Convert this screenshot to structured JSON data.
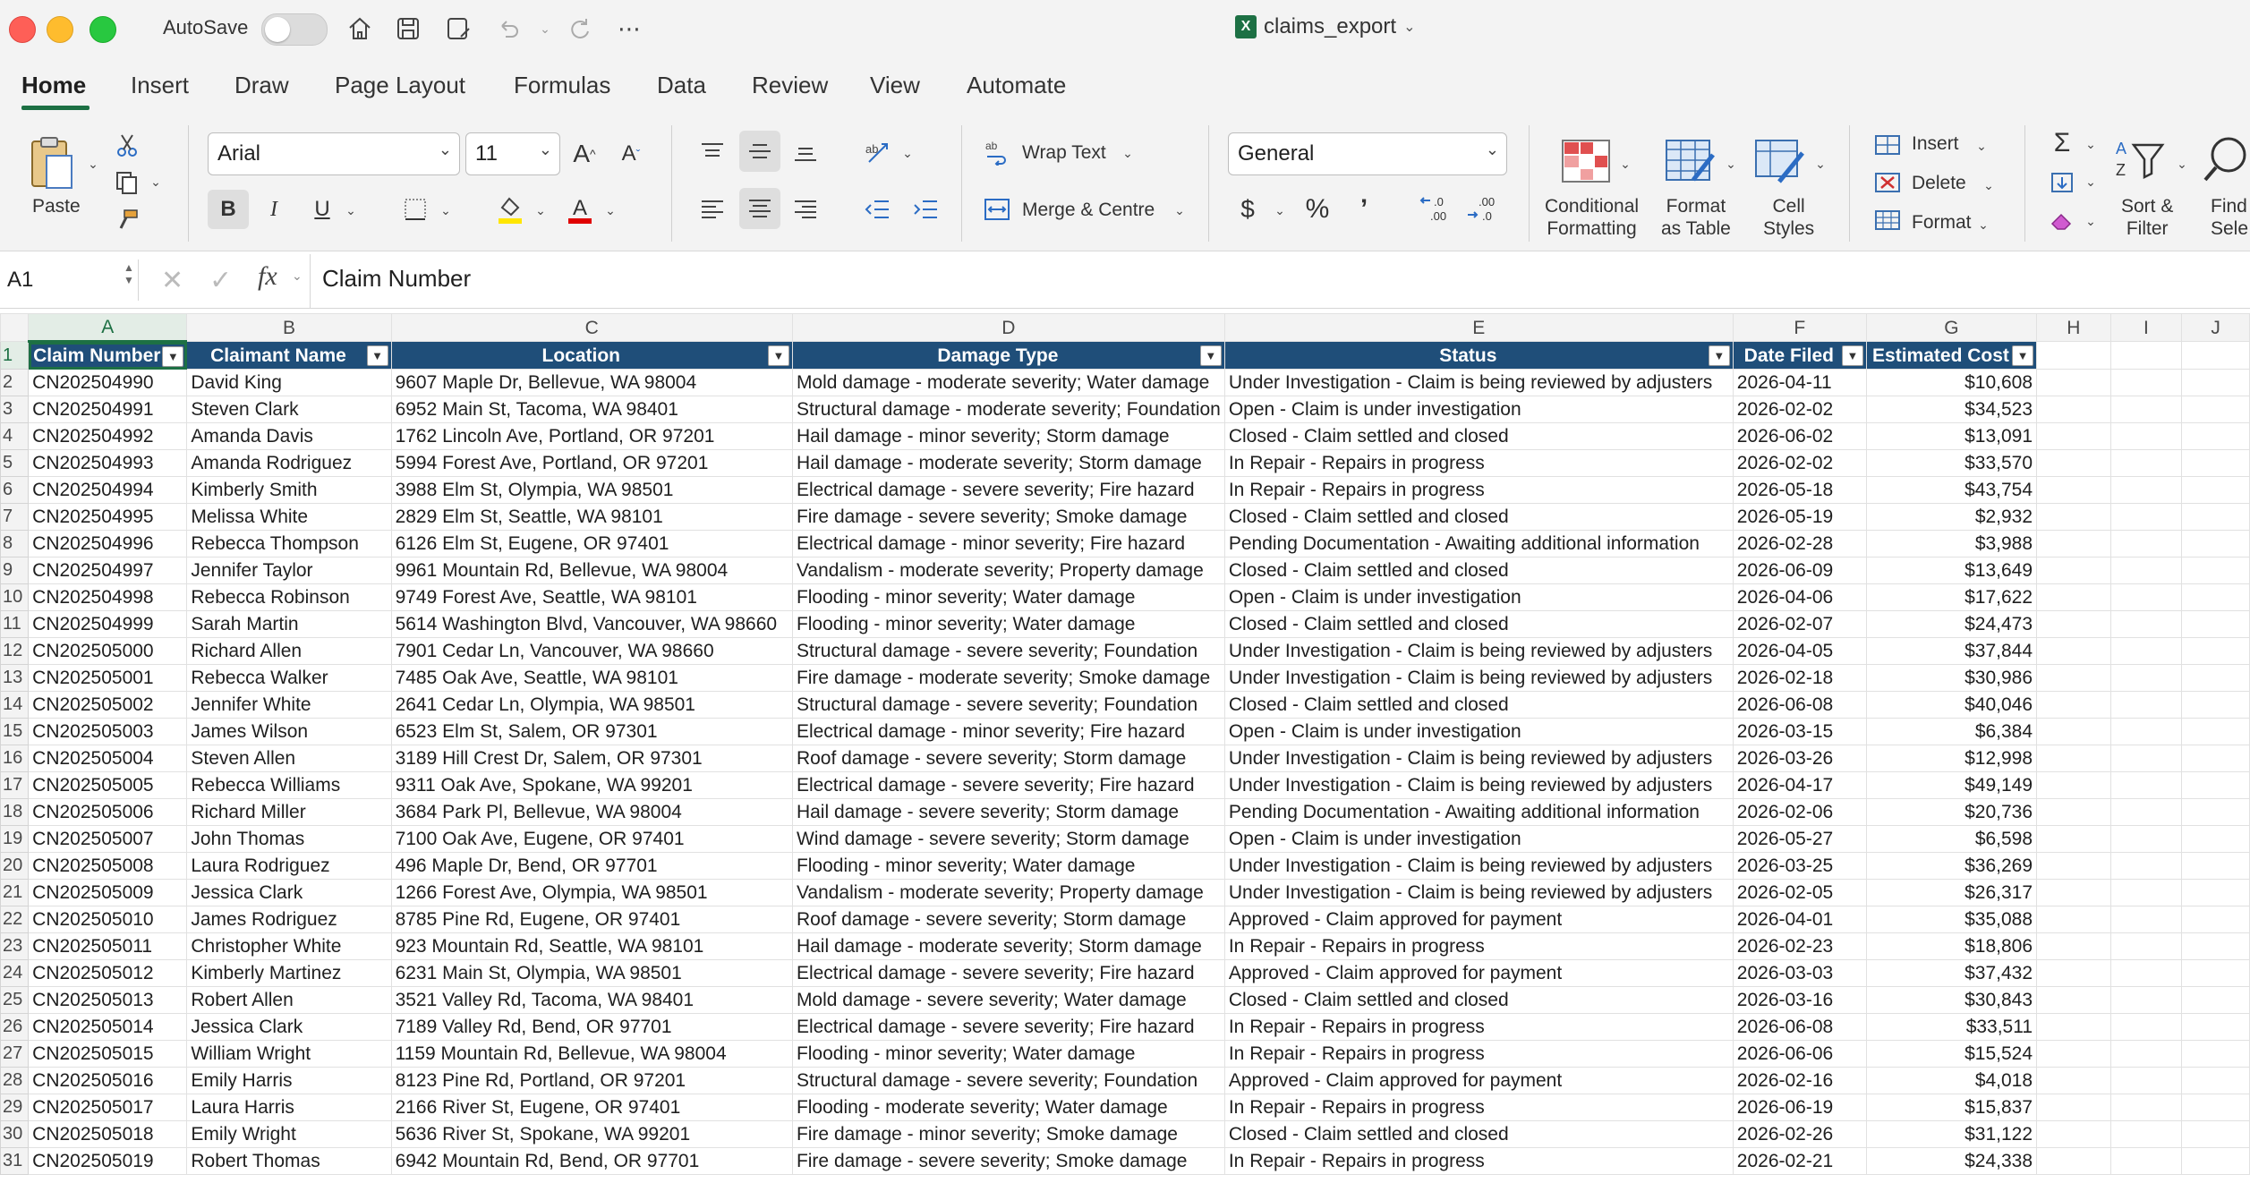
{
  "app": {
    "autosave_label": "AutoSave",
    "doc_title": "claims_export",
    "xl_badge": "X"
  },
  "tabs": [
    {
      "label": "Home"
    },
    {
      "label": "Insert"
    },
    {
      "label": "Draw"
    },
    {
      "label": "Page Layout"
    },
    {
      "label": "Formulas"
    },
    {
      "label": "Data"
    },
    {
      "label": "Review"
    },
    {
      "label": "View"
    },
    {
      "label": "Automate"
    }
  ],
  "ribbon": {
    "paste_label": "Paste",
    "font_name": "Arial",
    "font_size": "11",
    "wrap_text_label": "Wrap Text",
    "merge_label": "Merge & Centre",
    "number_format": "General",
    "cond_format_line1": "Conditional",
    "cond_format_line2": "Formatting",
    "format_table_line1": "Format",
    "format_table_line2": "as Table",
    "cell_styles_line1": "Cell",
    "cell_styles_line2": "Styles",
    "insert_label": "Insert",
    "delete_label": "Delete",
    "format_label": "Format",
    "sort_filter_line1": "Sort &",
    "sort_filter_line2": "Filter",
    "find_line1": "Find",
    "find_line2": "Sele",
    "accent_color": "#1d7044",
    "fill_color": "#ffe600",
    "font_color": "#e00000"
  },
  "formula_bar": {
    "name_box": "A1",
    "fx_label": "fx",
    "formula": "Claim Number"
  },
  "sheet": {
    "columns": [
      "A",
      "B",
      "C",
      "D",
      "E",
      "F",
      "G",
      "H",
      "I",
      "J"
    ],
    "headers": [
      "Claim Number",
      "Claimant Name",
      "Location",
      "Damage Type",
      "Status",
      "Date Filed",
      "Estimated Cost"
    ],
    "header_color": "#1f4e79",
    "rows": [
      [
        "CN202504990",
        "David King",
        "9607 Maple Dr, Bellevue, WA 98004",
        "Mold damage - moderate severity; Water damage",
        "Under Investigation - Claim is being reviewed by adjusters",
        "2026-04-11",
        "$10,608"
      ],
      [
        "CN202504991",
        "Steven Clark",
        "6952 Main St, Tacoma, WA 98401",
        "Structural damage - moderate severity; Foundation",
        "Open - Claim is under investigation",
        "2026-02-02",
        "$34,523"
      ],
      [
        "CN202504992",
        "Amanda Davis",
        "1762 Lincoln Ave, Portland, OR 97201",
        "Hail damage - minor severity; Storm damage",
        "Closed - Claim settled and closed",
        "2026-06-02",
        "$13,091"
      ],
      [
        "CN202504993",
        "Amanda Rodriguez",
        "5994 Forest Ave, Portland, OR 97201",
        "Hail damage - moderate severity; Storm damage",
        "In Repair - Repairs in progress",
        "2026-02-02",
        "$33,570"
      ],
      [
        "CN202504994",
        "Kimberly Smith",
        "3988 Elm St, Olympia, WA 98501",
        "Electrical damage - severe severity; Fire hazard",
        "In Repair - Repairs in progress",
        "2026-05-18",
        "$43,754"
      ],
      [
        "CN202504995",
        "Melissa White",
        "2829 Elm St, Seattle, WA 98101",
        "Fire damage - severe severity; Smoke damage",
        "Closed - Claim settled and closed",
        "2026-05-19",
        "$2,932"
      ],
      [
        "CN202504996",
        "Rebecca Thompson",
        "6126 Elm St, Eugene, OR 97401",
        "Electrical damage - minor severity; Fire hazard",
        "Pending Documentation - Awaiting additional information",
        "2026-02-28",
        "$3,988"
      ],
      [
        "CN202504997",
        "Jennifer Taylor",
        "9961 Mountain Rd, Bellevue, WA 98004",
        "Vandalism - moderate severity; Property damage",
        "Closed - Claim settled and closed",
        "2026-06-09",
        "$13,649"
      ],
      [
        "CN202504998",
        "Rebecca Robinson",
        "9749 Forest Ave, Seattle, WA 98101",
        "Flooding - minor severity; Water damage",
        "Open - Claim is under investigation",
        "2026-04-06",
        "$17,622"
      ],
      [
        "CN202504999",
        "Sarah Martin",
        "5614 Washington Blvd, Vancouver, WA 98660",
        "Flooding - minor severity; Water damage",
        "Closed - Claim settled and closed",
        "2026-02-07",
        "$24,473"
      ],
      [
        "CN202505000",
        "Richard Allen",
        "7901 Cedar Ln, Vancouver, WA 98660",
        "Structural damage - severe severity; Foundation",
        "Under Investigation - Claim is being reviewed by adjusters",
        "2026-04-05",
        "$37,844"
      ],
      [
        "CN202505001",
        "Rebecca Walker",
        "7485 Oak Ave, Seattle, WA 98101",
        "Fire damage - moderate severity; Smoke damage",
        "Under Investigation - Claim is being reviewed by adjusters",
        "2026-02-18",
        "$30,986"
      ],
      [
        "CN202505002",
        "Jennifer White",
        "2641 Cedar Ln, Olympia, WA 98501",
        "Structural damage - severe severity; Foundation",
        "Closed - Claim settled and closed",
        "2026-06-08",
        "$40,046"
      ],
      [
        "CN202505003",
        "James Wilson",
        "6523 Elm St, Salem, OR 97301",
        "Electrical damage - minor severity; Fire hazard",
        "Open - Claim is under investigation",
        "2026-03-15",
        "$6,384"
      ],
      [
        "CN202505004",
        "Steven Allen",
        "3189 Hill Crest Dr, Salem, OR 97301",
        "Roof damage - severe severity; Storm damage",
        "Under Investigation - Claim is being reviewed by adjusters",
        "2026-03-26",
        "$12,998"
      ],
      [
        "CN202505005",
        "Rebecca Williams",
        "9311 Oak Ave, Spokane, WA 99201",
        "Electrical damage - severe severity; Fire hazard",
        "Under Investigation - Claim is being reviewed by adjusters",
        "2026-04-17",
        "$49,149"
      ],
      [
        "CN202505006",
        "Richard Miller",
        "3684 Park Pl, Bellevue, WA 98004",
        "Hail damage - severe severity; Storm damage",
        "Pending Documentation - Awaiting additional information",
        "2026-02-06",
        "$20,736"
      ],
      [
        "CN202505007",
        "John Thomas",
        "7100 Oak Ave, Eugene, OR 97401",
        "Wind damage - severe severity; Storm damage",
        "Open - Claim is under investigation",
        "2026-05-27",
        "$6,598"
      ],
      [
        "CN202505008",
        "Laura Rodriguez",
        "496 Maple Dr, Bend, OR 97701",
        "Flooding - minor severity; Water damage",
        "Under Investigation - Claim is being reviewed by adjusters",
        "2026-03-25",
        "$36,269"
      ],
      [
        "CN202505009",
        "Jessica Clark",
        "1266 Forest Ave, Olympia, WA 98501",
        "Vandalism - moderate severity; Property damage",
        "Under Investigation - Claim is being reviewed by adjusters",
        "2026-02-05",
        "$26,317"
      ],
      [
        "CN202505010",
        "James Rodriguez",
        "8785 Pine Rd, Eugene, OR 97401",
        "Roof damage - severe severity; Storm damage",
        "Approved - Claim approved for payment",
        "2026-04-01",
        "$35,088"
      ],
      [
        "CN202505011",
        "Christopher White",
        "923 Mountain Rd, Seattle, WA 98101",
        "Hail damage - moderate severity; Storm damage",
        "In Repair - Repairs in progress",
        "2026-02-23",
        "$18,806"
      ],
      [
        "CN202505012",
        "Kimberly Martinez",
        "6231 Main St, Olympia, WA 98501",
        "Electrical damage - severe severity; Fire hazard",
        "Approved - Claim approved for payment",
        "2026-03-03",
        "$37,432"
      ],
      [
        "CN202505013",
        "Robert Allen",
        "3521 Valley Rd, Tacoma, WA 98401",
        "Mold damage - severe severity; Water damage",
        "Closed - Claim settled and closed",
        "2026-03-16",
        "$30,843"
      ],
      [
        "CN202505014",
        "Jessica Clark",
        "7189 Valley Rd, Bend, OR 97701",
        "Electrical damage - severe severity; Fire hazard",
        "In Repair - Repairs in progress",
        "2026-06-08",
        "$33,511"
      ],
      [
        "CN202505015",
        "William Wright",
        "1159 Mountain Rd, Bellevue, WA 98004",
        "Flooding - minor severity; Water damage",
        "In Repair - Repairs in progress",
        "2026-06-06",
        "$15,524"
      ],
      [
        "CN202505016",
        "Emily Harris",
        "8123 Pine Rd, Portland, OR 97201",
        "Structural damage - severe severity; Foundation",
        "Approved - Claim approved for payment",
        "2026-02-16",
        "$4,018"
      ],
      [
        "CN202505017",
        "Laura Harris",
        "2166 River St, Eugene, OR 97401",
        "Flooding - moderate severity; Water damage",
        "In Repair - Repairs in progress",
        "2026-06-19",
        "$15,837"
      ],
      [
        "CN202505018",
        "Emily Wright",
        "5636 River St, Spokane, WA 99201",
        "Fire damage - minor severity; Smoke damage",
        "Closed - Claim settled and closed",
        "2026-02-26",
        "$31,122"
      ],
      [
        "CN202505019",
        "Robert Thomas",
        "6942 Mountain Rd, Bend, OR 97701",
        "Fire damage - severe severity; Smoke damage",
        "In Repair - Repairs in progress",
        "2026-02-21",
        "$24,338"
      ]
    ]
  }
}
